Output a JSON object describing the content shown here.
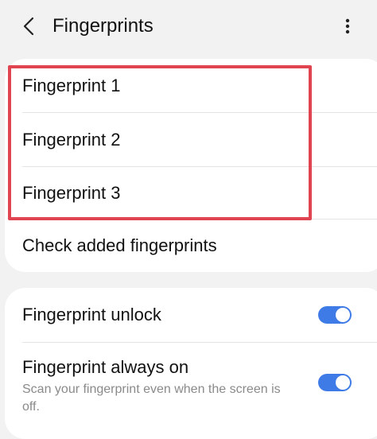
{
  "header": {
    "title": "Fingerprints",
    "back_icon": "chevron-left-icon",
    "more_icon": "more-vertical-icon"
  },
  "fingerprints": {
    "items": [
      {
        "label": "Fingerprint 1"
      },
      {
        "label": "Fingerprint 2"
      },
      {
        "label": "Fingerprint 3"
      }
    ],
    "check_label": "Check added fingerprints",
    "highlight_color": "#e04450"
  },
  "settings": {
    "unlock": {
      "label": "Fingerprint unlock",
      "enabled": true
    },
    "always_on": {
      "label": "Fingerprint always on",
      "description": "Scan your fingerprint even when the screen is off.",
      "enabled": true
    },
    "toggle_color": "#3e7be6"
  }
}
